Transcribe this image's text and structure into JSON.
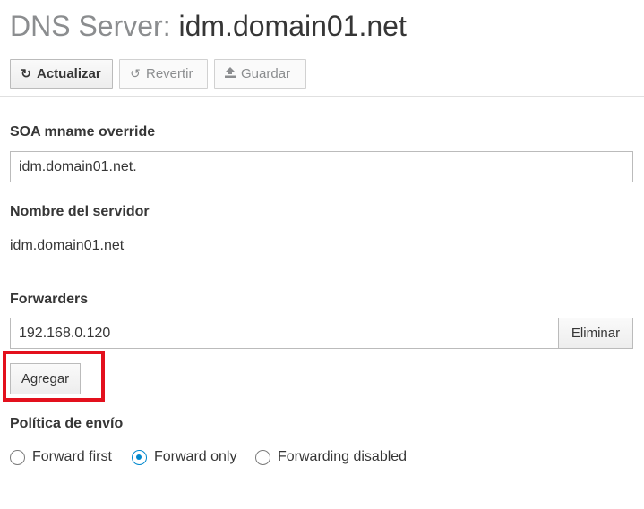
{
  "page": {
    "title_label": "DNS Server:",
    "title_value": "idm.domain01.net"
  },
  "toolbar": {
    "refresh_label": "Actualizar",
    "revert_label": "Revertir",
    "save_label": "Guardar"
  },
  "form": {
    "soa_label": "SOA mname override",
    "soa_value": "idm.domain01.net.",
    "server_name_label": "Nombre del servidor",
    "server_name_value": "idm.domain01.net",
    "forwarders_label": "Forwarders",
    "forwarders": [
      {
        "value": "192.168.0.120",
        "remove_label": "Eliminar"
      }
    ],
    "add_label": "Agregar",
    "policy_label": "Política de envío",
    "policy_options": [
      {
        "label": "Forward first",
        "checked": false
      },
      {
        "label": "Forward only",
        "checked": true
      },
      {
        "label": "Forwarding disabled",
        "checked": false
      }
    ]
  },
  "colors": {
    "accent": "#0088ce",
    "highlight": "#e3101d"
  }
}
